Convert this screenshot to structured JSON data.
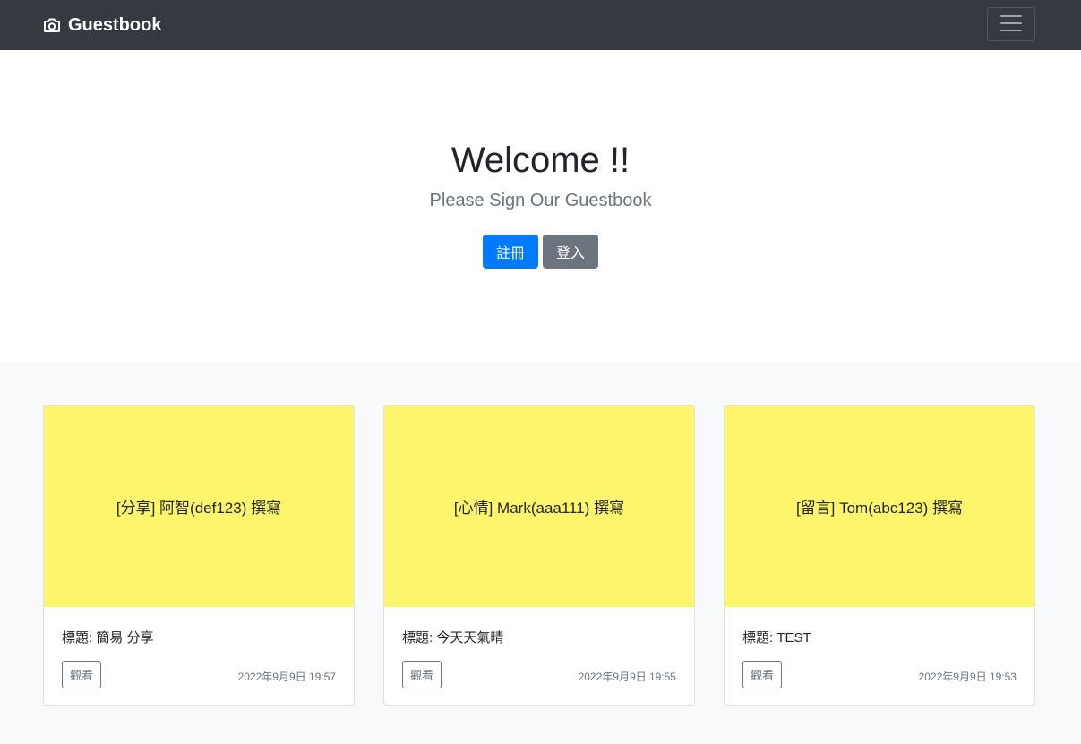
{
  "navbar": {
    "brand": "Guestbook",
    "brand_icon": "camera-icon",
    "toggler_icon": "hamburger-menu-icon"
  },
  "hero": {
    "heading": "Welcome !!",
    "lead": "Please Sign Our Guestbook",
    "register_label": "註冊",
    "login_label": "登入"
  },
  "colors": {
    "navbar_bg": "#343a40",
    "primary": "#007bff",
    "secondary": "#6c757d",
    "card_thumb_bg": "#fdf56c",
    "album_bg": "#f8f9fa"
  },
  "cards": [
    {
      "thumb_text": "[分享] 阿智(def123) 撰寫",
      "title": "標題: 簡易 分享",
      "view_label": "觀看",
      "date": "2022年9月9日 19:57"
    },
    {
      "thumb_text": "[心情] Mark(aaa111) 撰寫",
      "title": "標題: 今天天氣晴",
      "view_label": "觀看",
      "date": "2022年9月9日 19:55"
    },
    {
      "thumb_text": "[留言] Tom(abc123) 撰寫",
      "title": "標題: TEST",
      "view_label": "觀看",
      "date": "2022年9月9日 19:53"
    }
  ]
}
